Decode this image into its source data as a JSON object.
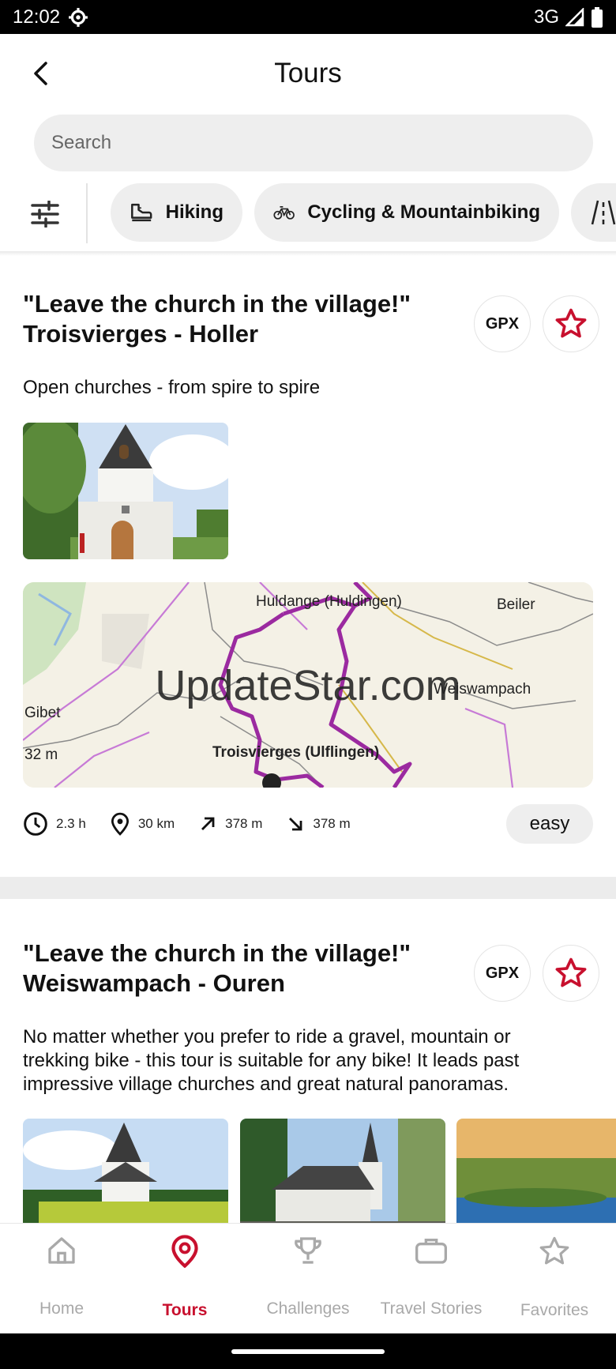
{
  "status_bar": {
    "time": "12:02",
    "network": "3G"
  },
  "header": {
    "title": "Tours"
  },
  "search": {
    "placeholder": "Search"
  },
  "filters": {
    "chips": [
      {
        "label": "Hiking",
        "icon": "hiking-boot-icon"
      },
      {
        "label": "Cycling & Mountainbiking",
        "icon": "bicycle-icon"
      },
      {
        "label": "",
        "icon": "road-icon"
      }
    ]
  },
  "tours": [
    {
      "title": "\"Leave the church in the village!\" Troisvierges - Holler",
      "title_line1": "\"Leave the church in the village!\"",
      "title_line2": "Troisvierges - Holler",
      "gpx_label": "GPX",
      "description": "Open churches - from spire to spire",
      "map": {
        "watermark": "UpdateStar.com",
        "labels": [
          "Huldange (Huldingen)",
          "Beiler",
          "Weiswampach",
          "Gibet",
          "32 m",
          "Troisvierges (Ulflingen)"
        ]
      },
      "stats": {
        "duration": "2.3 h",
        "distance": "30 km",
        "ascent": "378 m",
        "descent": "378 m"
      },
      "difficulty": "easy"
    },
    {
      "title": "\"Leave the church in the village!\" Weiswampach - Ouren",
      "title_line1": "\"Leave the church in the village!\"",
      "title_line2": "Weiswampach - Ouren",
      "gpx_label": "GPX",
      "description": "No matter whether you prefer to ride a gravel, mountain or trekking bike - this tour is suitable for any bike! It leads past impressive village churches and great natural panoramas."
    }
  ],
  "bottom_nav": [
    {
      "label": "Home",
      "icon": "home-icon",
      "active": false
    },
    {
      "label": "Tours",
      "icon": "map-pin-icon",
      "active": true
    },
    {
      "label": "Challenges",
      "icon": "trophy-icon",
      "active": false
    },
    {
      "label": "Travel Stories",
      "icon": "briefcase-icon",
      "active": false
    },
    {
      "label": "Favorites",
      "icon": "star-icon",
      "active": false
    }
  ],
  "colors": {
    "accent": "#c8102e",
    "chip_bg": "#eeeeee",
    "route": "#9b2aa0"
  }
}
